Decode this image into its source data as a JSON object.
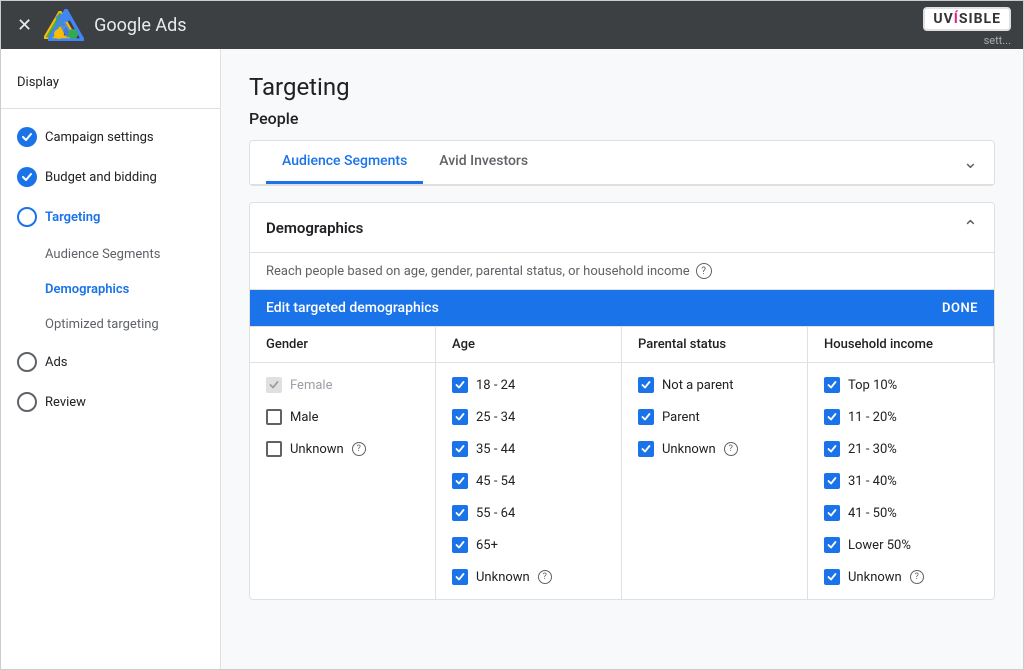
{
  "app": {
    "close_label": "✕",
    "title": "Google Ads",
    "uvisible": "UVíSIBLE",
    "settings_label": "sett..."
  },
  "sidebar": {
    "section_label": "Display",
    "items": [
      {
        "id": "campaign-settings",
        "label": "Campaign settings",
        "state": "checked",
        "level": "top"
      },
      {
        "id": "budget-bidding",
        "label": "Budget and bidding",
        "state": "checked",
        "level": "top"
      },
      {
        "id": "targeting",
        "label": "Targeting",
        "state": "open-blue",
        "level": "top"
      },
      {
        "id": "audience-segments",
        "label": "Audience Segments",
        "state": "sub",
        "level": "sub"
      },
      {
        "id": "demographics",
        "label": "Demographics",
        "state": "sub-active",
        "level": "sub"
      },
      {
        "id": "optimized-targeting",
        "label": "Optimized targeting",
        "state": "sub",
        "level": "sub"
      },
      {
        "id": "ads",
        "label": "Ads",
        "state": "open",
        "level": "top"
      },
      {
        "id": "review",
        "label": "Review",
        "state": "open",
        "level": "top"
      }
    ]
  },
  "main": {
    "page_title": "Targeting",
    "section_people": "People",
    "tabs": [
      {
        "id": "audience-segments",
        "label": "Audience Segments",
        "active": true
      },
      {
        "id": "avid-investors",
        "label": "Avid Investors",
        "active": false
      }
    ],
    "demographics": {
      "title": "Demographics",
      "description": "Reach people based on age, gender, parental status, or household income",
      "edit_bar_title": "Edit targeted demographics",
      "done_label": "DONE",
      "columns": [
        {
          "header": "Gender",
          "rows": [
            {
              "label": "Female",
              "state": "disabled"
            },
            {
              "label": "Male",
              "state": "unchecked"
            },
            {
              "label": "Unknown",
              "state": "unchecked",
              "has_info": true
            }
          ]
        },
        {
          "header": "Age",
          "rows": [
            {
              "label": "18 - 24",
              "state": "checked"
            },
            {
              "label": "25 - 34",
              "state": "checked"
            },
            {
              "label": "35 - 44",
              "state": "checked"
            },
            {
              "label": "45 - 54",
              "state": "checked"
            },
            {
              "label": "55 - 64",
              "state": "checked"
            },
            {
              "label": "65+",
              "state": "checked"
            },
            {
              "label": "Unknown",
              "state": "checked",
              "has_info": true
            }
          ]
        },
        {
          "header": "Parental status",
          "rows": [
            {
              "label": "Not a parent",
              "state": "checked"
            },
            {
              "label": "Parent",
              "state": "checked"
            },
            {
              "label": "Unknown",
              "state": "checked",
              "has_info": true
            }
          ]
        },
        {
          "header": "Household income",
          "rows": [
            {
              "label": "Top 10%",
              "state": "checked"
            },
            {
              "label": "11 - 20%",
              "state": "checked"
            },
            {
              "label": "21 - 30%",
              "state": "checked"
            },
            {
              "label": "31 - 40%",
              "state": "checked"
            },
            {
              "label": "41 - 50%",
              "state": "checked"
            },
            {
              "label": "Lower 50%",
              "state": "checked"
            },
            {
              "label": "Unknown",
              "state": "checked",
              "has_info": true
            }
          ]
        }
      ]
    }
  }
}
